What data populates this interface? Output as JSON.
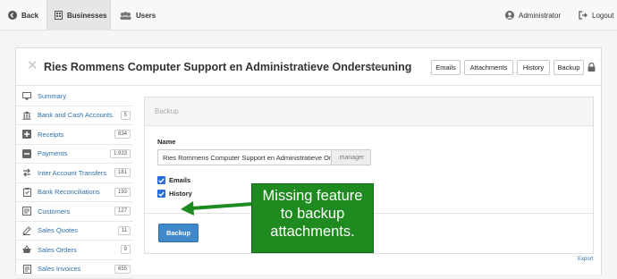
{
  "nav": {
    "back": "Back",
    "businesses": "Businesses",
    "users": "Users",
    "user": "Administrator",
    "logout": "Logout"
  },
  "header": {
    "title": "Ries Rommens Computer Support en Administratieve Ondersteuning",
    "rename": "Rename",
    "buttons": [
      "Emails",
      "Attachments",
      "History",
      "Backup"
    ]
  },
  "sidebar": {
    "items": [
      {
        "label": "Summary",
        "badge": "",
        "icon": "monitor-icon"
      },
      {
        "label": "Bank and Cash Accounts",
        "badge": "5",
        "icon": "bank-icon"
      },
      {
        "label": "Receipts",
        "badge": "834",
        "icon": "plus-box-icon"
      },
      {
        "label": "Payments",
        "badge": "1.933",
        "icon": "minus-box-icon"
      },
      {
        "label": "Inter Account Transfers",
        "badge": "181",
        "icon": "transfer-icon"
      },
      {
        "label": "Bank Reconciliations",
        "badge": "193",
        "icon": "clipboard-icon"
      },
      {
        "label": "Customers",
        "badge": "127",
        "icon": "customers-icon"
      },
      {
        "label": "Sales Quotes",
        "badge": "11",
        "icon": "quote-icon"
      },
      {
        "label": "Sales Orders",
        "badge": "9",
        "icon": "basket-icon"
      },
      {
        "label": "Sales Invoices",
        "badge": "655",
        "icon": "invoice-icon"
      }
    ]
  },
  "backup_form": {
    "title": "Backup",
    "name_label": "Name",
    "name_value": "Ries Rommens Computer Support en Administratieve Onder",
    "name_suffix": ".manager",
    "emails_label": "Emails",
    "history_label": "History",
    "submit": "Backup",
    "export": "Export"
  },
  "annotation": {
    "lines": [
      "Missing feature",
      "to backup",
      "attachments."
    ]
  },
  "colors": {
    "link": "#2f6fa9",
    "primary": "#3f88c9",
    "annotation": "#1f8a1f",
    "checkbox": "#2a6dd9"
  }
}
